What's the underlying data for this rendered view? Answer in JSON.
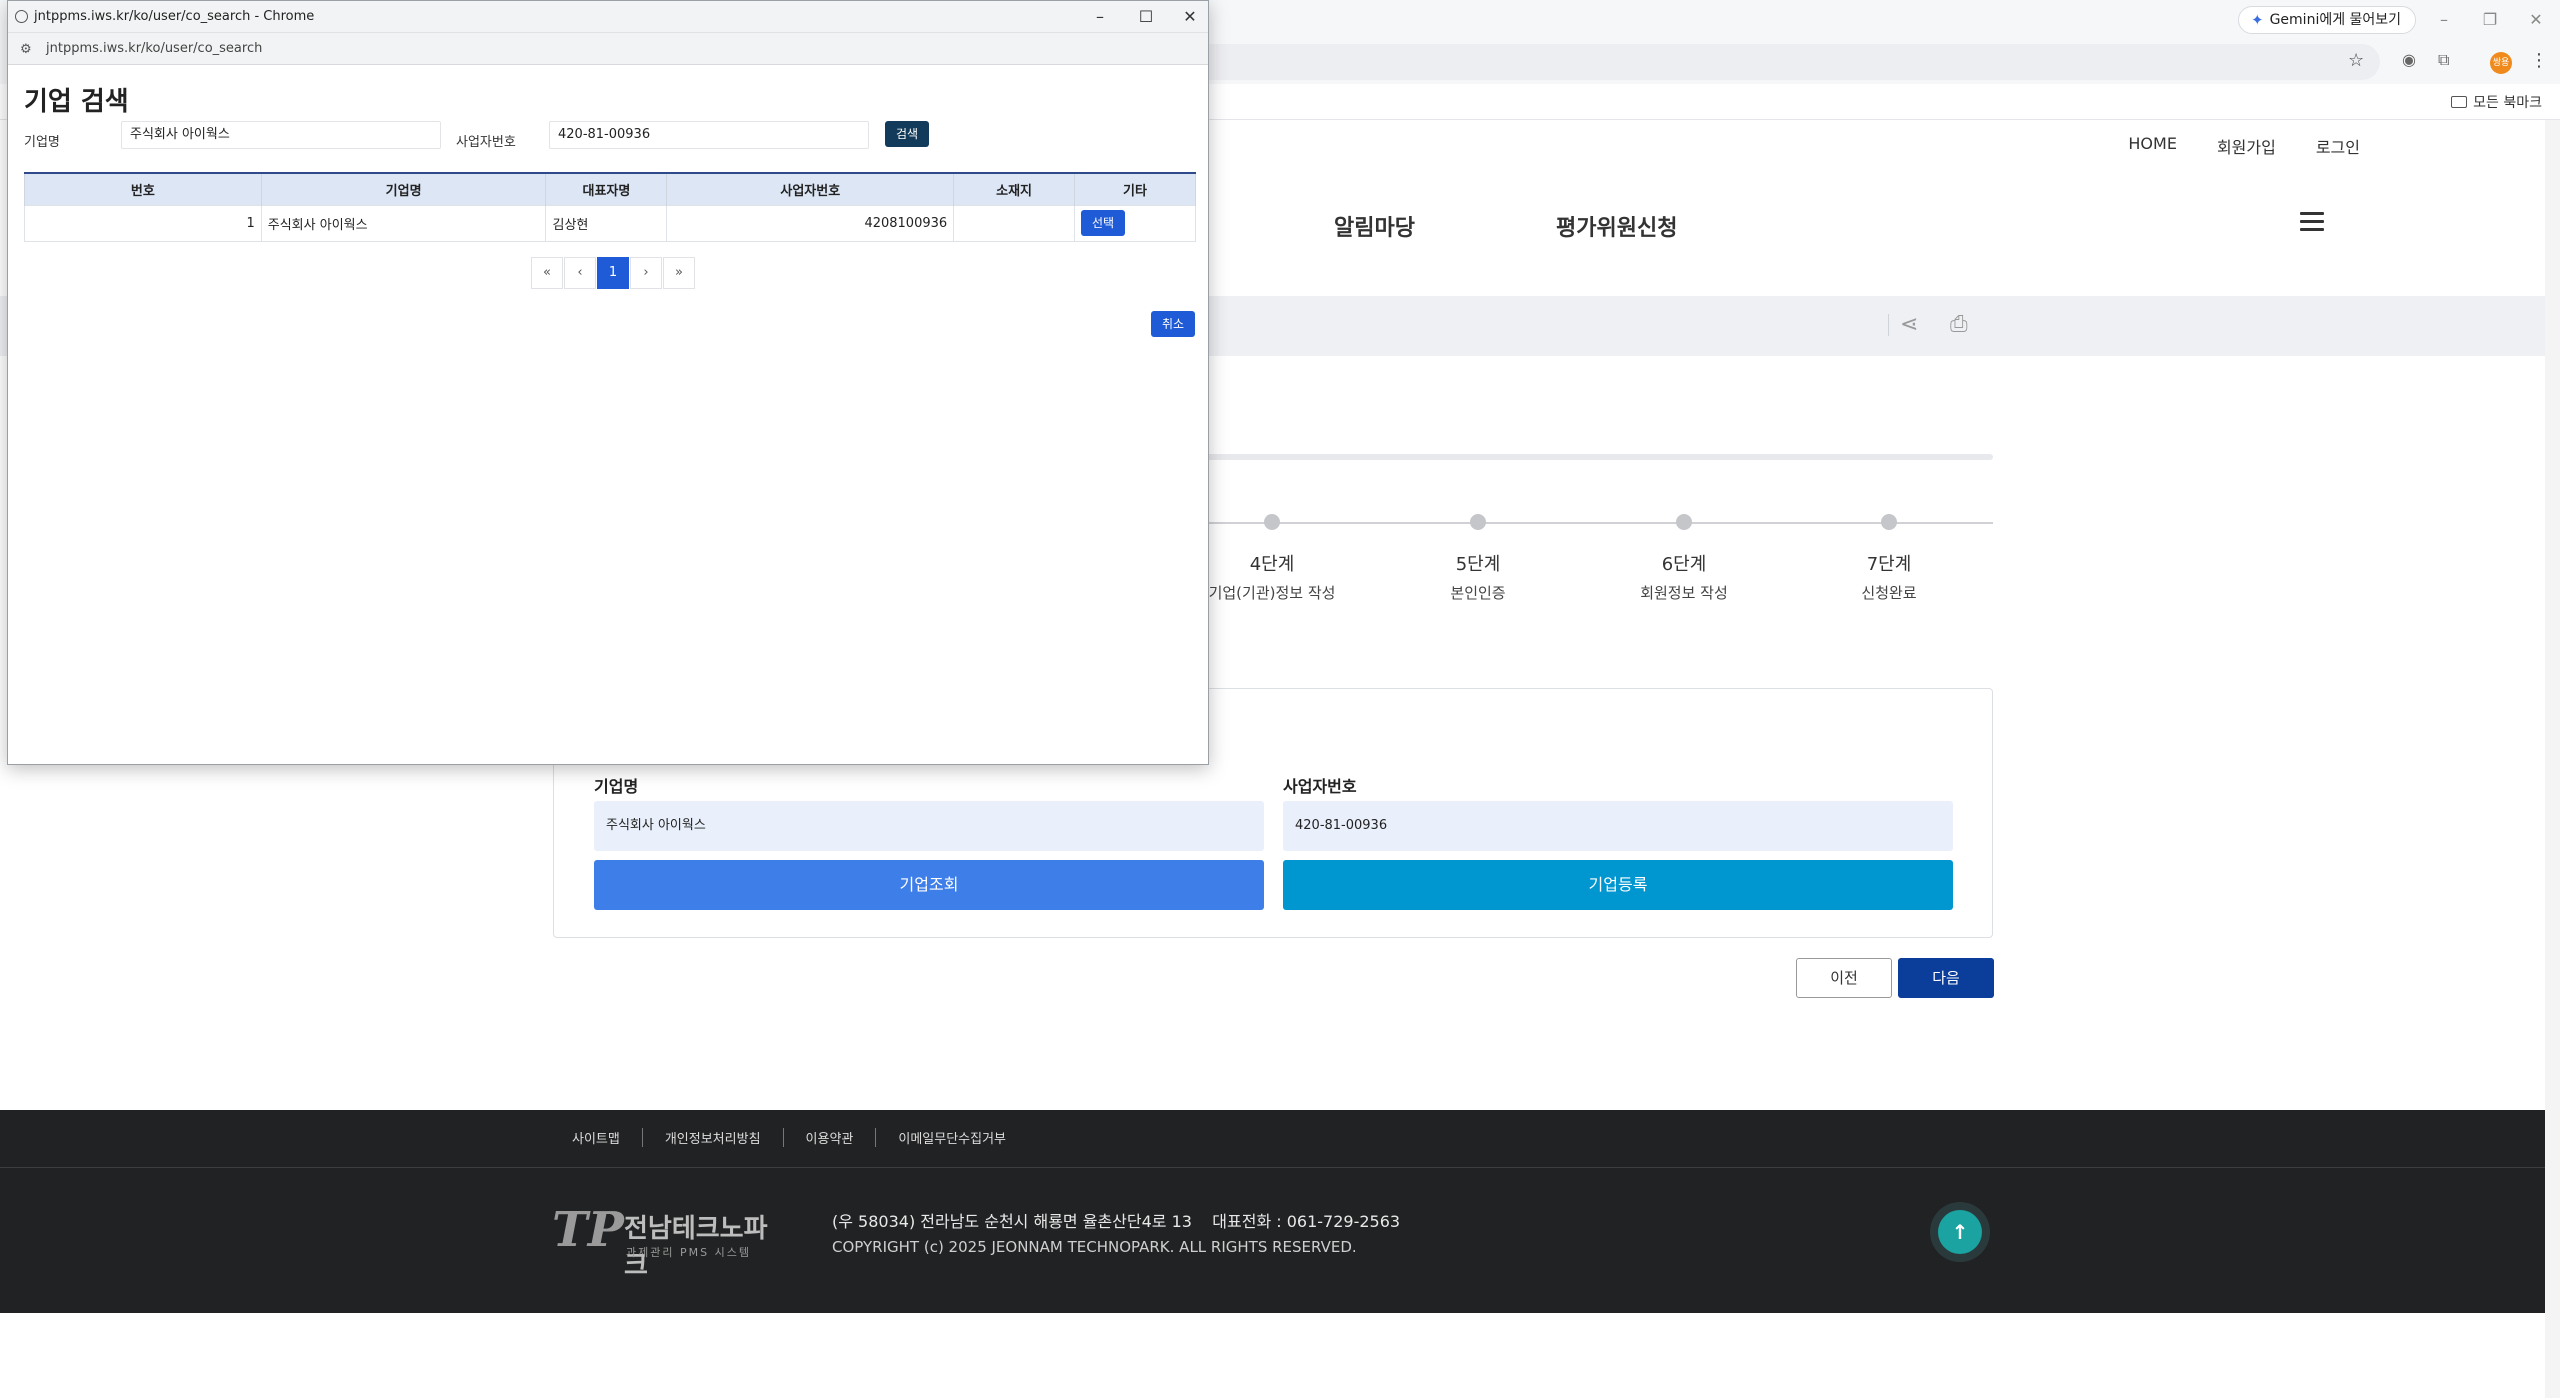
{
  "browser": {
    "gemini_label": "Gemini에게 물어보기",
    "profile_initial": "쌍용",
    "all_bookmarks": "모든 북마크"
  },
  "site": {
    "topnav": [
      "HOME",
      "회원가입",
      "로그인"
    ],
    "gnb": [
      "알림마당",
      "평가위원신청"
    ]
  },
  "steps": [
    {
      "num": "4단계",
      "label": "기업(기관)정보 작성"
    },
    {
      "num": "5단계",
      "label": "본인인증"
    },
    {
      "num": "6단계",
      "label": "회원정보 작성"
    },
    {
      "num": "7단계",
      "label": "신청완료"
    }
  ],
  "form": {
    "company_label": "기업명",
    "company_value": "주식회사 아이웍스",
    "bizno_label": "사업자번호",
    "bizno_value": "420-81-00936",
    "lookup_button": "기업조회",
    "register_button": "기업등록",
    "prev_button": "이전",
    "next_button": "다음",
    "colors": {
      "lookup": "#3e7ee8",
      "register": "#0096d0",
      "next": "#0b3d9a"
    }
  },
  "footer": {
    "links": [
      "사이트맵",
      "개인정보처리방침",
      "이용약관",
      "이메일무단수집거부"
    ],
    "logo_mark": "TP",
    "logo_name": "전남테크노파크",
    "logo_sub": "과제관리 PMS 시스템",
    "address": "(우 58034) 전라남도 순천시 해룡면 율촌산단4로 13    대표전화 : 061-729-2563",
    "copyright": "COPYRIGHT (c) 2025 JEONNAM TECHNOPARK. ALL RIGHTS RESERVED."
  },
  "popup": {
    "window_title": "jntppms.iws.kr/ko/user/co_search - Chrome",
    "url": "jntppms.iws.kr/ko/user/co_search",
    "heading": "기업 검색",
    "company_label": "기업명",
    "company_value": "주식회사 아이웍스",
    "bizno_label": "사업자번호",
    "bizno_value": "420-81-00936",
    "search_button": "검색",
    "table": {
      "headers": [
        "번호",
        "기업명",
        "대표자명",
        "사업자번호",
        "소재지",
        "기타"
      ],
      "row": {
        "no": "1",
        "company": "주식회사 아이웍스",
        "ceo": "김상현",
        "bizno": "4208100936",
        "location": "",
        "action": "선택"
      }
    },
    "pager": [
      "«",
      "‹",
      "1",
      "›",
      "»"
    ],
    "cancel_button": "취소"
  }
}
